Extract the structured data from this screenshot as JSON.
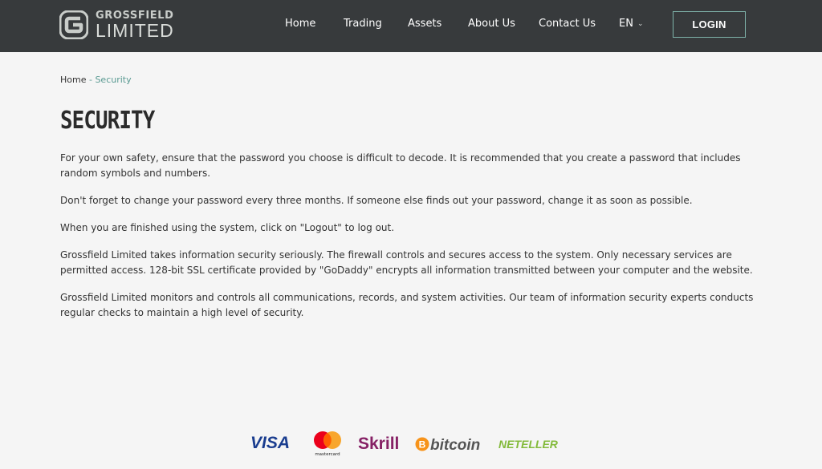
{
  "brand": {
    "line1": "GROSSFIELD",
    "line2": "LIMITED",
    "mark_letter": "G"
  },
  "nav": {
    "items": [
      {
        "label": "Home"
      },
      {
        "label": "Trading"
      },
      {
        "label": "Assets"
      },
      {
        "label": "About Us"
      },
      {
        "label": "Contact Us"
      }
    ],
    "language": "EN",
    "login_label": "LOGIN"
  },
  "breadcrumb": {
    "home": "Home",
    "separator": " - ",
    "current": "Security"
  },
  "page": {
    "title": "SECURITY",
    "paragraphs": [
      "For your own safety, ensure that the password you choose is difficult to decode. It is recommended that you create a password that includes random symbols and numbers.",
      "Don't forget to change your password every three months. If someone else finds out your password, change it as soon as possible.",
      "When you are finished using the system, click on \"Logout\" to log out.",
      "Grossfield Limited takes information security seriously. The firewall controls and secures access to the system. Only necessary services are permitted access. 128-bit SSL certificate provided by \"GoDaddy\" encrypts all information transmitted between your computer and the website.",
      "Grossfield Limited monitors and controls all communications, records, and system activities. Our team of information security experts conducts regular checks to maintain a high level of security."
    ]
  },
  "payments": {
    "visa": "VISA",
    "mastercard": "mastercard",
    "skrill": "Skrill",
    "bitcoin": "bitcoin",
    "bitcoin_symbol": "B",
    "neteller": "NETELLER"
  },
  "colors": {
    "header_bg": "#373a3c",
    "accent": "#5a9a92",
    "login_border": "#7fb3aa",
    "page_bg": "#f5f5f5",
    "visa": "#1a3d8f",
    "visa_accent": "#3da3c6",
    "mastercard_red": "#eb001b",
    "mastercard_orange": "#f79e1b",
    "skrill": "#862165",
    "bitcoin": "#f7931a",
    "neteller": "#83ba3b"
  }
}
